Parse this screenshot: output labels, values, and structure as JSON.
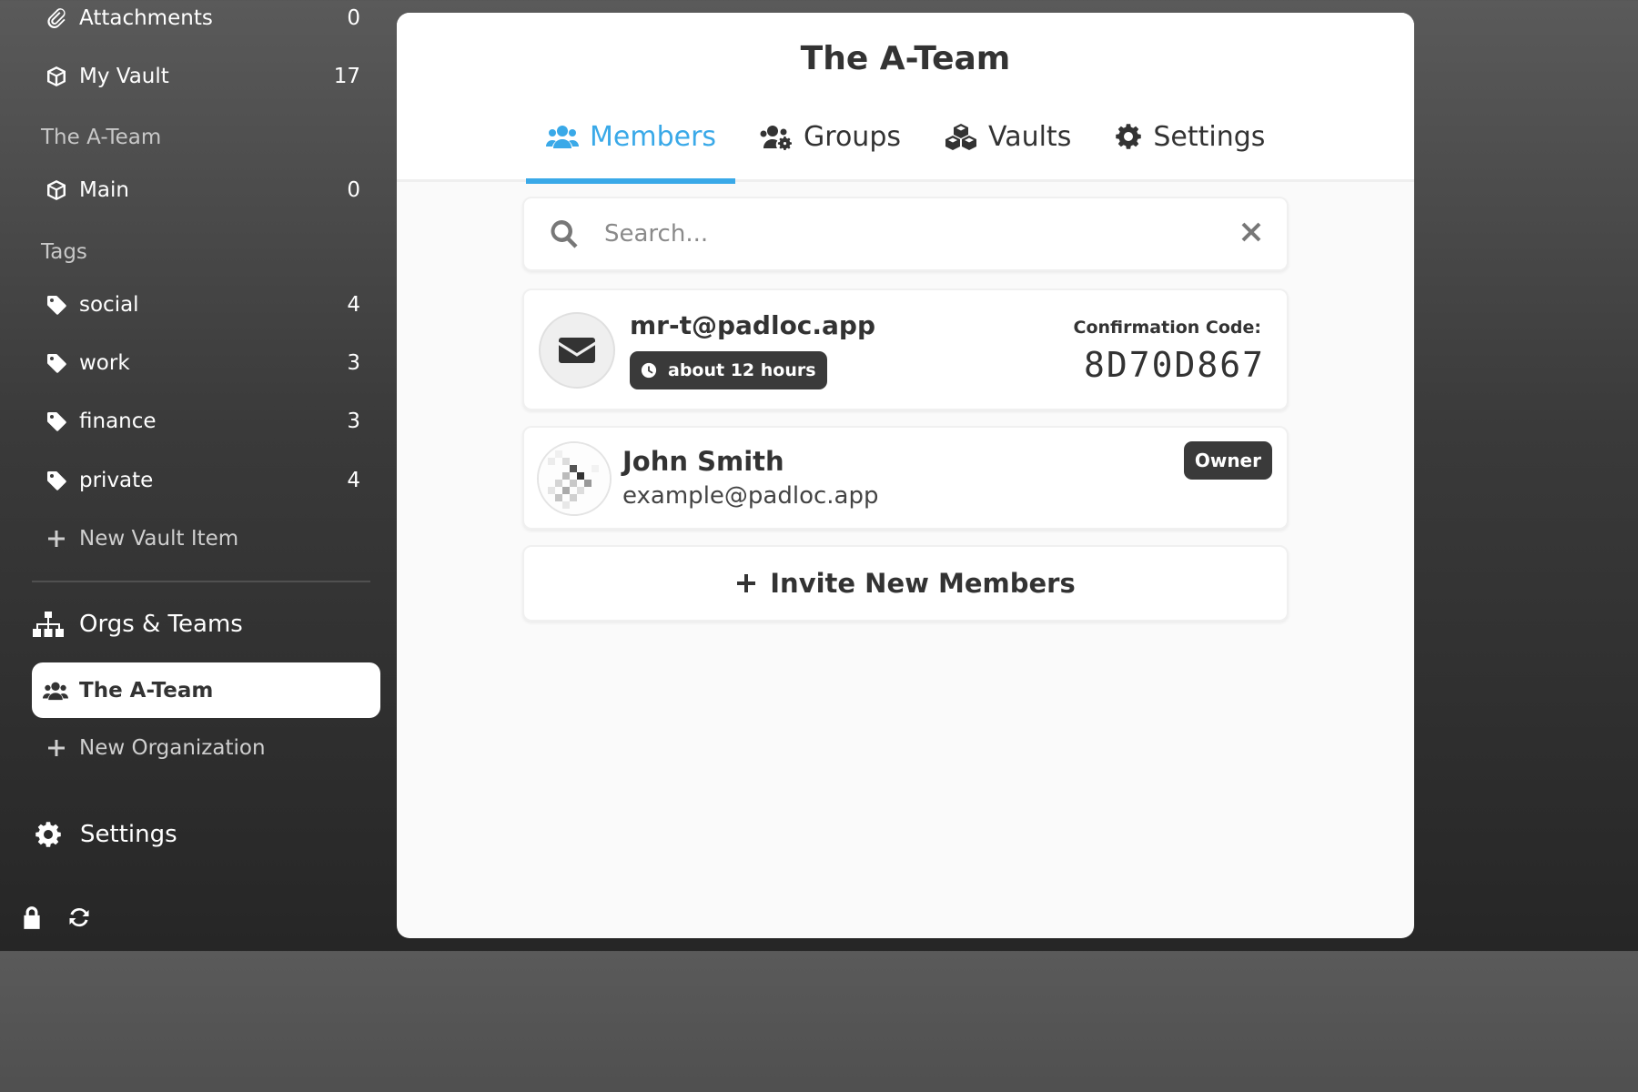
{
  "sidebar": {
    "vault_items": [
      {
        "label": "Attachments",
        "count": "0",
        "icon": "paperclip-icon"
      },
      {
        "label": "My Vault",
        "count": "17",
        "icon": "cube-icon"
      }
    ],
    "org_section_title": "The A-Team",
    "org_vaults": [
      {
        "label": "Main",
        "count": "0",
        "icon": "cube-icon"
      }
    ],
    "tags_title": "Tags",
    "tags": [
      {
        "label": "social",
        "count": "4"
      },
      {
        "label": "work",
        "count": "3"
      },
      {
        "label": "finance",
        "count": "3"
      },
      {
        "label": "private",
        "count": "4"
      }
    ],
    "new_vault_item": "New Vault Item",
    "orgs_heading": "Orgs & Teams",
    "active_org": "The A-Team",
    "new_org": "New Organization",
    "settings": "Settings"
  },
  "main": {
    "title": "The A-Team",
    "tabs": [
      {
        "label": "Members",
        "icon": "users-icon",
        "active": true
      },
      {
        "label": "Groups",
        "icon": "users-cog-icon",
        "active": false
      },
      {
        "label": "Vaults",
        "icon": "cubes-icon",
        "active": false
      },
      {
        "label": "Settings",
        "icon": "gear-icon",
        "active": false
      }
    ],
    "search": {
      "placeholder": "Search...",
      "value": ""
    },
    "invite": {
      "email": "mr-t@padloc.app",
      "time": "about 12 hours",
      "code_label": "Confirmation Code:",
      "code": "8D70D867"
    },
    "member": {
      "name": "John Smith",
      "email": "example@padloc.app",
      "role": "Owner"
    },
    "invite_button": "Invite New Members"
  },
  "colors": {
    "accent": "#3aa9e8",
    "sidebar_top": "#5a5a5a",
    "sidebar_bottom": "#262626",
    "badge": "#3a3a3a"
  }
}
